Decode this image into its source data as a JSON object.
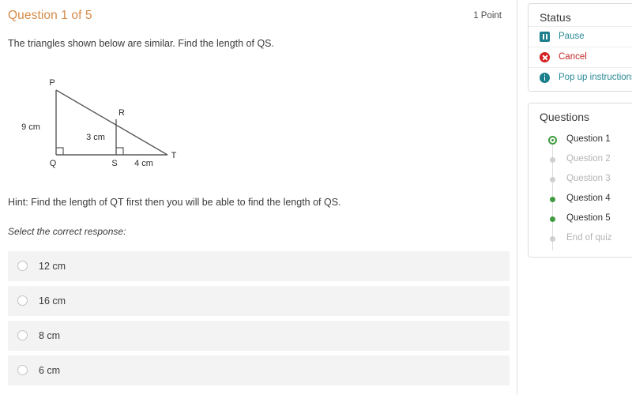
{
  "question": {
    "header": "Question 1 of 5",
    "points": "1 Point",
    "text": "The triangles shown below are similar.  Find the length of QS.",
    "hint": "Hint:  Find the length of QT first then you will be able to find the length of QS.",
    "select_prompt": "Select the correct response:"
  },
  "figure": {
    "vertices": {
      "P": "P",
      "Q": "Q",
      "R": "R",
      "S": "S",
      "T": "T"
    },
    "measurements": {
      "pq": "9 cm",
      "rs": "3 cm",
      "st": "4 cm"
    }
  },
  "options": [
    {
      "label": "12 cm",
      "selected": false
    },
    {
      "label": "16 cm",
      "selected": false
    },
    {
      "label": "8 cm",
      "selected": false
    },
    {
      "label": "6 cm",
      "selected": false
    }
  ],
  "sidebar": {
    "status": {
      "title": "Status",
      "items": [
        {
          "label": "Pause",
          "icon": "pause-icon",
          "color": "#2a8a96"
        },
        {
          "label": "Cancel",
          "icon": "cancel-icon",
          "color": "#c62828"
        },
        {
          "label": "Pop up instructions",
          "icon": "info-icon",
          "color": "#2a8a96"
        }
      ]
    },
    "questions": {
      "title": "Questions",
      "items": [
        {
          "label": "Question 1",
          "state": "current"
        },
        {
          "label": "Question 2",
          "state": "todo"
        },
        {
          "label": "Question 3",
          "state": "todo"
        },
        {
          "label": "Question 4",
          "state": "done"
        },
        {
          "label": "Question 5",
          "state": "done"
        },
        {
          "label": "End of quiz",
          "state": "todo"
        }
      ]
    }
  },
  "colors": {
    "accent_orange": "#d58a47",
    "teal": "#2a8a96",
    "red": "#c62828",
    "green": "#3f9b3f",
    "option_bg": "#f3f3f3"
  }
}
